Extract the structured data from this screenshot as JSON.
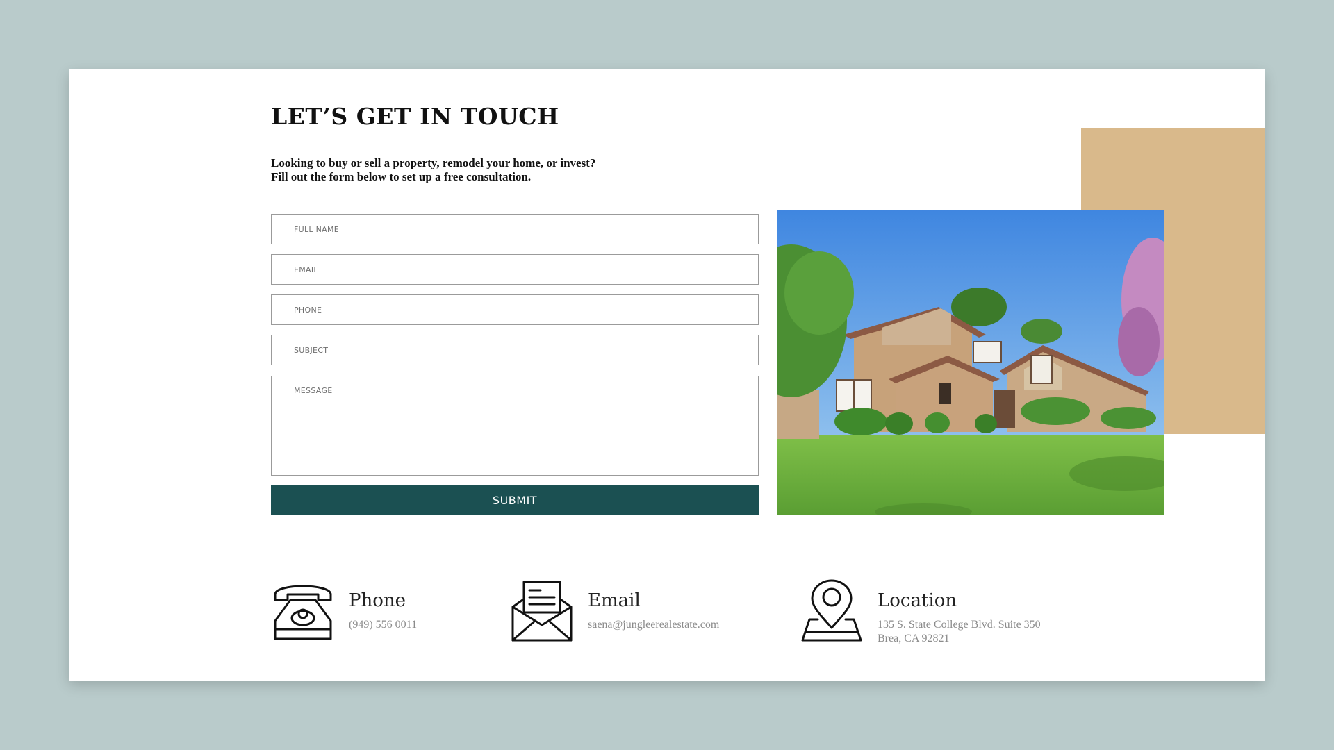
{
  "header": {
    "title": "LET’S GET IN TOUCH",
    "subtitle_line1": "Looking to buy or sell a property, remodel your home, or invest?",
    "subtitle_line2": "Fill out the form below to set up a free consultation."
  },
  "form": {
    "full_name_placeholder": "FULL NAME",
    "email_placeholder": "EMAIL",
    "phone_placeholder": "PHONE",
    "subject_placeholder": "SUBJECT",
    "message_placeholder": "MESSAGE",
    "submit_label": "SUBMIT"
  },
  "contacts": {
    "phone": {
      "label": "Phone",
      "value": "(949) 556 0011",
      "icon": "telephone-icon"
    },
    "email": {
      "label": "Email",
      "value": "saena@jungleerealestate.com",
      "icon": "envelope-icon"
    },
    "location": {
      "label": "Location",
      "value_line1": "135 S. State College Blvd. Suite 350",
      "value_line2": "Brea, CA 92821",
      "icon": "map-pin-icon"
    }
  },
  "colors": {
    "background": "#b9cbcb",
    "card": "#ffffff",
    "accent_tan": "#d9b98b",
    "submit_button": "#1b5052"
  }
}
